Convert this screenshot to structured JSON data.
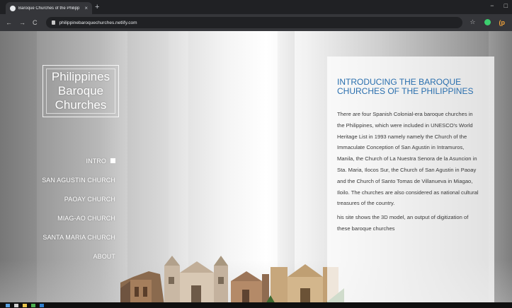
{
  "browser": {
    "tab_title": "Baroque Churches of the Philipp",
    "tab_close": "×",
    "new_tab": "+",
    "url": "philippinebaroquechurches.netlify.com",
    "window_controls": [
      "−",
      "□"
    ],
    "icons": [
      "back-icon",
      "forward-icon",
      "reload-icon",
      "lock-icon",
      "star-icon",
      "extension-icon",
      "profile-icon"
    ]
  },
  "logo": {
    "line1": "Philippines",
    "line2": "Baroque",
    "line3": "Churches"
  },
  "nav": {
    "items": [
      {
        "label": "INTRO",
        "active": true
      },
      {
        "label": "SAN AGUSTIN CHURCH",
        "active": false
      },
      {
        "label": "PAOAY CHURCH",
        "active": false
      },
      {
        "label": "MIAG-AO CHURCH",
        "active": false
      },
      {
        "label": "SANTA MARIA CHURCH",
        "active": false
      },
      {
        "label": "ABOUT",
        "active": false
      }
    ]
  },
  "panel": {
    "title": "INTRODUCING THE BAROQUE CHURCHES OF THE PHILIPPINES",
    "paragraph1": "There are four Spanish Colonial-era baroque churches in the Philippines, which were included in UNESCO's World Heritage List in 1993 namely namely the Church of the Immaculate Conception of San Agustin in Intramuros, Manila, the Church of La Nuestra Senora de la Asuncion in Sta. Maria, Ilocos Sur, the Church of San Agustin in Paoay and the Church of Santo Tomas de Villanueva in Miagao, Iloilo. The churches are also considered as national cultural treasures of the country.",
    "paragraph2": "his site shows the 3D model, an output of digitization of these baroque churches"
  },
  "colors": {
    "title_blue": "#2a6fae",
    "browser_dark": "#202124",
    "browser_mid": "#35363a"
  }
}
